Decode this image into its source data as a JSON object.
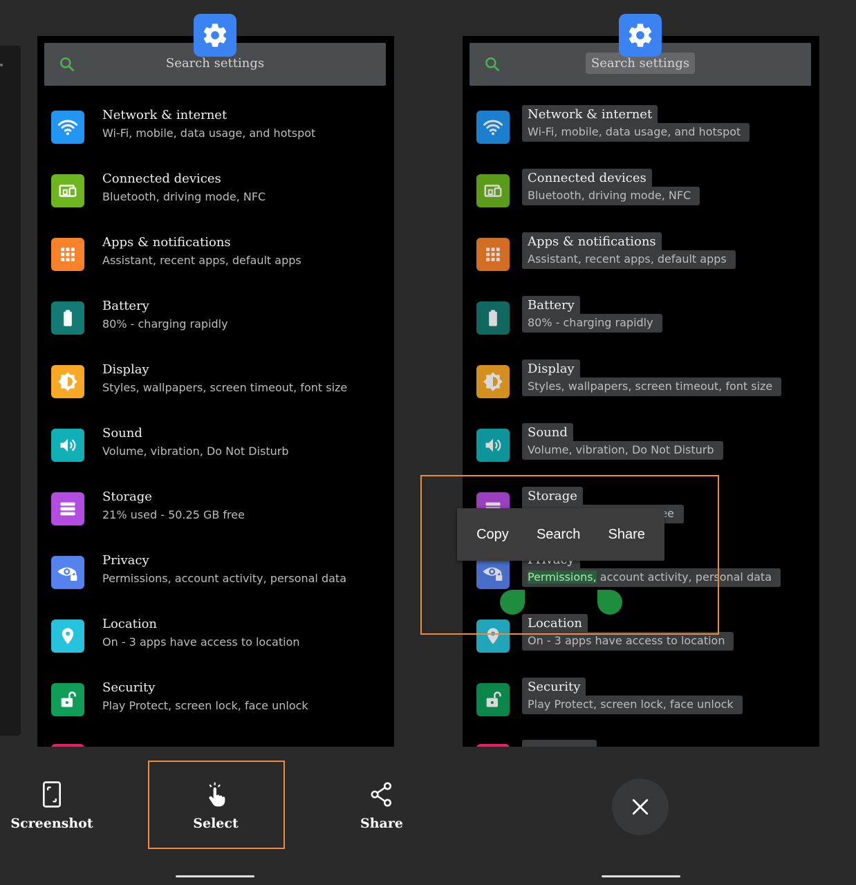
{
  "search": {
    "placeholder": "Search settings"
  },
  "settings": [
    {
      "title": "Network & internet",
      "subtitle": "Wi-Fi, mobile, data usage, and hotspot",
      "icon": "wifi-icon",
      "color": "#2196f3"
    },
    {
      "title": "Connected devices",
      "subtitle": "Bluetooth, driving mode, NFC",
      "icon": "devices-icon",
      "color": "#6db61f"
    },
    {
      "title": "Apps & notifications",
      "subtitle": "Assistant, recent apps, default apps",
      "icon": "apps-grid-icon",
      "color": "#f7822a"
    },
    {
      "title": "Battery",
      "subtitle": "80% - charging rapidly",
      "icon": "battery-icon",
      "color": "#137b73"
    },
    {
      "title": "Display",
      "subtitle": "Styles, wallpapers, screen timeout, font size",
      "icon": "brightness-icon",
      "color": "#f8a825"
    },
    {
      "title": "Sound",
      "subtitle": "Volume, vibration, Do Not Disturb",
      "icon": "volume-icon",
      "color": "#10b0b6"
    },
    {
      "title": "Storage",
      "subtitle": "21% used - 50.25 GB free",
      "icon": "storage-icon",
      "color": "#b34ce0"
    },
    {
      "title": "Privacy",
      "subtitle": "Permissions, account activity, personal data",
      "icon": "privacy-eye-icon",
      "color": "#5682ee"
    },
    {
      "title": "Location",
      "subtitle": "On - 3 apps have access to location",
      "icon": "location-pin-icon",
      "color": "#27c2db"
    },
    {
      "title": "Security",
      "subtitle": "Play Protect, screen lock, face unlock",
      "icon": "unlock-icon",
      "color": "#0f9d58"
    }
  ],
  "selection": {
    "highlighted": "Permissions,",
    "rest": " account activity, personal data",
    "storage_partial": "ee",
    "privacy_partial": "Privacy"
  },
  "context_menu": {
    "copy": "Copy",
    "search": "Search",
    "share": "Share"
  },
  "toolbar": {
    "screenshot": "Screenshot",
    "select": "Select",
    "share": "Share"
  },
  "colors": {
    "accent_orange": "#f08a3c",
    "gear_blue": "#3b83f2",
    "handle_green": "#1e8e3e"
  }
}
